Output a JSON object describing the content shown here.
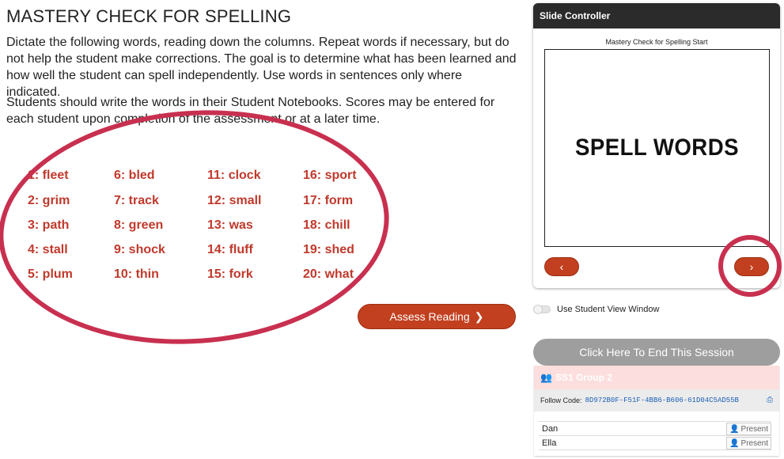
{
  "page": {
    "title": "MASTERY CHECK FOR SPELLING",
    "paragraph1": "Dictate the following words, reading down the columns. Repeat words if necessary, but do not help the student make corrections. The goal is to determine what has been learned and how well the student can spell independently. Use words in sentences only where indicated.",
    "paragraph2": "Students should write the words in their Student Notebooks. Scores may be entered for each student upon completion of the assessment or at a later time."
  },
  "words": [
    "1: fleet",
    "2: grim",
    "3: path",
    "4: stall",
    "5: plum",
    "6: bled",
    "7: track",
    "8: green",
    "9: shock",
    "10: thin",
    "11: clock",
    "12: small",
    "13: was",
    "14: fluff",
    "15: fork",
    "16: sport",
    "17: form",
    "18: chill",
    "19: shed",
    "20: what"
  ],
  "assess_button": {
    "label": "Assess Reading",
    "icon": "chevron-right-icon"
  },
  "slide_controller": {
    "title": "Slide Controller",
    "caption": "Mastery Check for Spelling Start",
    "slide_text": "SPELL WORDS",
    "prev_icon": "chevron-left-icon",
    "next_icon": "chevron-right-icon"
  },
  "toggle": {
    "label": "Use Student View Window",
    "on": false
  },
  "end_session": {
    "label": "Click Here To End This Session"
  },
  "group": {
    "name": "SS1 Group 2",
    "icon": "users-icon",
    "follow_label": "Follow Code:",
    "follow_code": "8D972B0F-F51F-4BB6-B606-61D04C5AD55B",
    "students": [
      {
        "name": "Dan",
        "status": "Present"
      },
      {
        "name": "Ella",
        "status": "Present"
      }
    ]
  },
  "colors": {
    "accent": "#c2401f",
    "word": "#c0392b",
    "highlight_circle": "#c8304f",
    "end_button": "#9e9e9e"
  }
}
